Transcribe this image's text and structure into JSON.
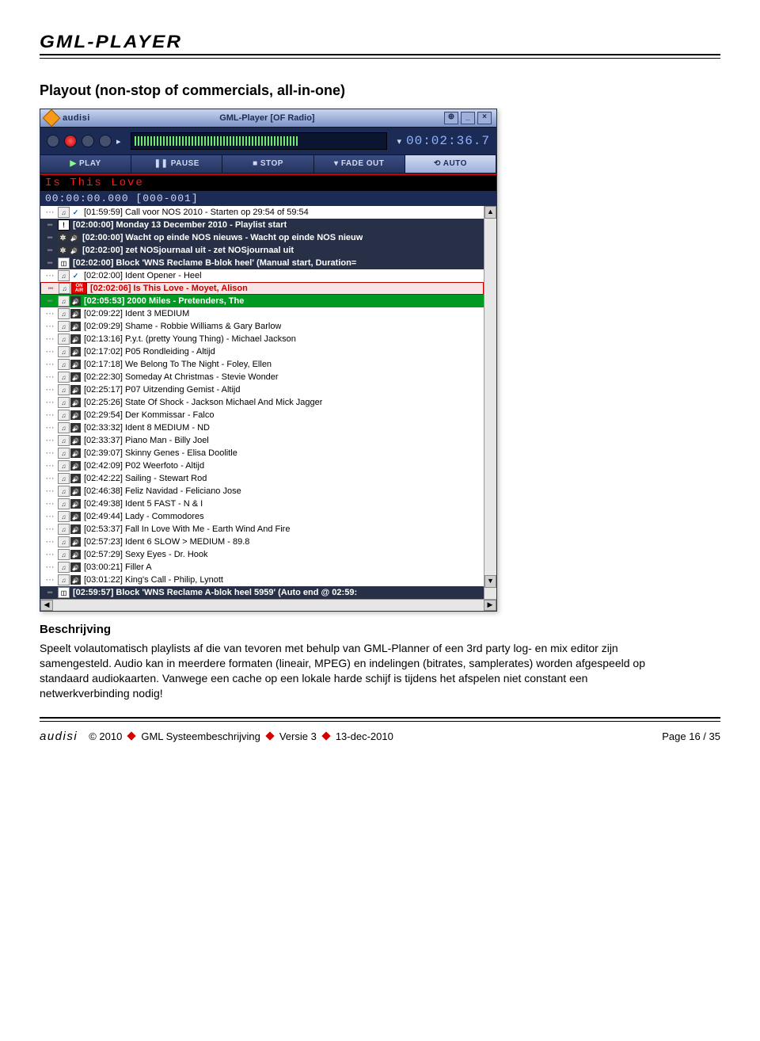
{
  "header": {
    "logo_text": "GML-PLAYER"
  },
  "section": {
    "title": "Playout (non-stop of commercials, all-in-one)"
  },
  "app": {
    "brand": "audisi",
    "title": "GML-Player [OF Radio]",
    "timer": "00:02:36.7",
    "transport": {
      "play": "PLAY",
      "pause": "PAUSE",
      "stop": "STOP",
      "fadeout": "FADE OUT",
      "auto": "AUTO"
    },
    "now_title": "Is This Love",
    "now_pos": "00:00:00.000 [000-001]",
    "playlist": [
      {
        "style": "",
        "icons": [
          "note",
          "chk"
        ],
        "text": "[01:59:59] Call voor NOS 2010 - Starten op 29:54 of 59:54"
      },
      {
        "style": "b-dark",
        "icons": [
          "excl"
        ],
        "text": "[02:00:00] Monday 13 December 2010 - Playlist start"
      },
      {
        "style": "b-dark",
        "icons": [
          "gear",
          "spk"
        ],
        "text": "[02:00:00] Wacht op einde NOS nieuws - Wacht op einde NOS nieuw"
      },
      {
        "style": "b-dark",
        "icons": [
          "gear",
          "spk"
        ],
        "text": "[02:02:00] zet NOSjournaal uit - zet NOSjournaal uit"
      },
      {
        "style": "b-dark",
        "icons": [
          "w"
        ],
        "text": "[02:02:00] Block 'WNS Reclame B-blok heel' (Manual start, Duration="
      },
      {
        "style": "",
        "icons": [
          "note",
          "chk"
        ],
        "text": "[02:02:00] Ident Opener - Heel"
      },
      {
        "style": "b-red",
        "icons": [
          "note",
          "onair"
        ],
        "text": "[02:02:06] Is This Love - Moyet, Alison"
      },
      {
        "style": "b-green",
        "icons": [
          "note",
          "spk"
        ],
        "text": "[02:05:53] 2000 Miles - Pretenders, The"
      },
      {
        "style": "",
        "icons": [
          "note",
          "spk"
        ],
        "text": "[02:09:22] Ident 3 MEDIUM"
      },
      {
        "style": "",
        "icons": [
          "note",
          "spk"
        ],
        "text": "[02:09:29] Shame - Robbie Williams & Gary Barlow"
      },
      {
        "style": "",
        "icons": [
          "note",
          "spk"
        ],
        "text": "[02:13:16] P.y.t. (pretty Young Thing) - Michael Jackson"
      },
      {
        "style": "",
        "icons": [
          "note",
          "spk"
        ],
        "text": "[02:17:02] P05 Rondleiding - Altijd"
      },
      {
        "style": "",
        "icons": [
          "note",
          "spk"
        ],
        "text": "[02:17:18] We Belong To The Night - Foley, Ellen"
      },
      {
        "style": "",
        "icons": [
          "note",
          "spk"
        ],
        "text": "[02:22:30] Someday At Christmas - Stevie Wonder"
      },
      {
        "style": "",
        "icons": [
          "note",
          "spk"
        ],
        "text": "[02:25:17] P07 Uitzending Gemist - Altijd"
      },
      {
        "style": "",
        "icons": [
          "note",
          "spk"
        ],
        "text": "[02:25:26] State Of Shock - Jackson Michael And Mick Jagger"
      },
      {
        "style": "",
        "icons": [
          "note",
          "spk"
        ],
        "text": "[02:29:54] Der Kommissar - Falco"
      },
      {
        "style": "",
        "icons": [
          "note",
          "spk"
        ],
        "text": "[02:33:32] Ident 8 MEDIUM - ND"
      },
      {
        "style": "",
        "icons": [
          "note",
          "spk"
        ],
        "text": "[02:33:37] Piano Man - Billy Joel"
      },
      {
        "style": "",
        "icons": [
          "note",
          "spk"
        ],
        "text": "[02:39:07] Skinny Genes - Elisa Doolitle"
      },
      {
        "style": "",
        "icons": [
          "note",
          "spk"
        ],
        "text": "[02:42:09] P02 Weerfoto - Altijd"
      },
      {
        "style": "",
        "icons": [
          "note",
          "spk"
        ],
        "text": "[02:42:22] Sailing - Stewart  Rod"
      },
      {
        "style": "",
        "icons": [
          "note",
          "spk"
        ],
        "text": "[02:46:38] Feliz Navidad - Feliciano  Jose"
      },
      {
        "style": "",
        "icons": [
          "note",
          "spk"
        ],
        "text": "[02:49:38] Ident 5 FAST - N & I"
      },
      {
        "style": "",
        "icons": [
          "note",
          "spk"
        ],
        "text": "[02:49:44] Lady - Commodores"
      },
      {
        "style": "",
        "icons": [
          "note",
          "spk"
        ],
        "text": "[02:53:37] Fall In Love With Me - Earth Wind And Fire"
      },
      {
        "style": "",
        "icons": [
          "note",
          "spk"
        ],
        "text": "[02:57:23] Ident 6 SLOW > MEDIUM - 89.8"
      },
      {
        "style": "",
        "icons": [
          "note",
          "spk"
        ],
        "text": "[02:57:29] Sexy Eyes - Dr. Hook"
      },
      {
        "style": "",
        "icons": [
          "note",
          "spk"
        ],
        "text": "[03:00:21] Filler A"
      },
      {
        "style": "",
        "icons": [
          "note",
          "spk"
        ],
        "text": "[03:01:22] King's Call - Philip, Lynott"
      },
      {
        "style": "b-dark",
        "icons": [
          "w"
        ],
        "text": "[02:59:57] Block 'WNS Reclame A-blok heel 5959' (Auto end @ 02:59:"
      }
    ]
  },
  "description": {
    "heading": "Beschrijving",
    "text": "Speelt volautomatisch playlists af die van tevoren met behulp van GML-Planner of een 3rd party log- en mix editor zijn samengesteld. Audio kan in meerdere formaten (lineair, MPEG) en indelingen (bitrates, samplerates) worden afgespeeld op standaard audiokaarten. Vanwege een cache op een lokale harde schijf is tijdens het afspelen niet constant een netwerkverbinding nodig!"
  },
  "footer": {
    "brand": "audisi",
    "copyright": "© 2010",
    "doc": "GML Systeembeschrijving",
    "version": "Versie 3",
    "date": "13-dec-2010",
    "page": "Page 16 / 35"
  }
}
